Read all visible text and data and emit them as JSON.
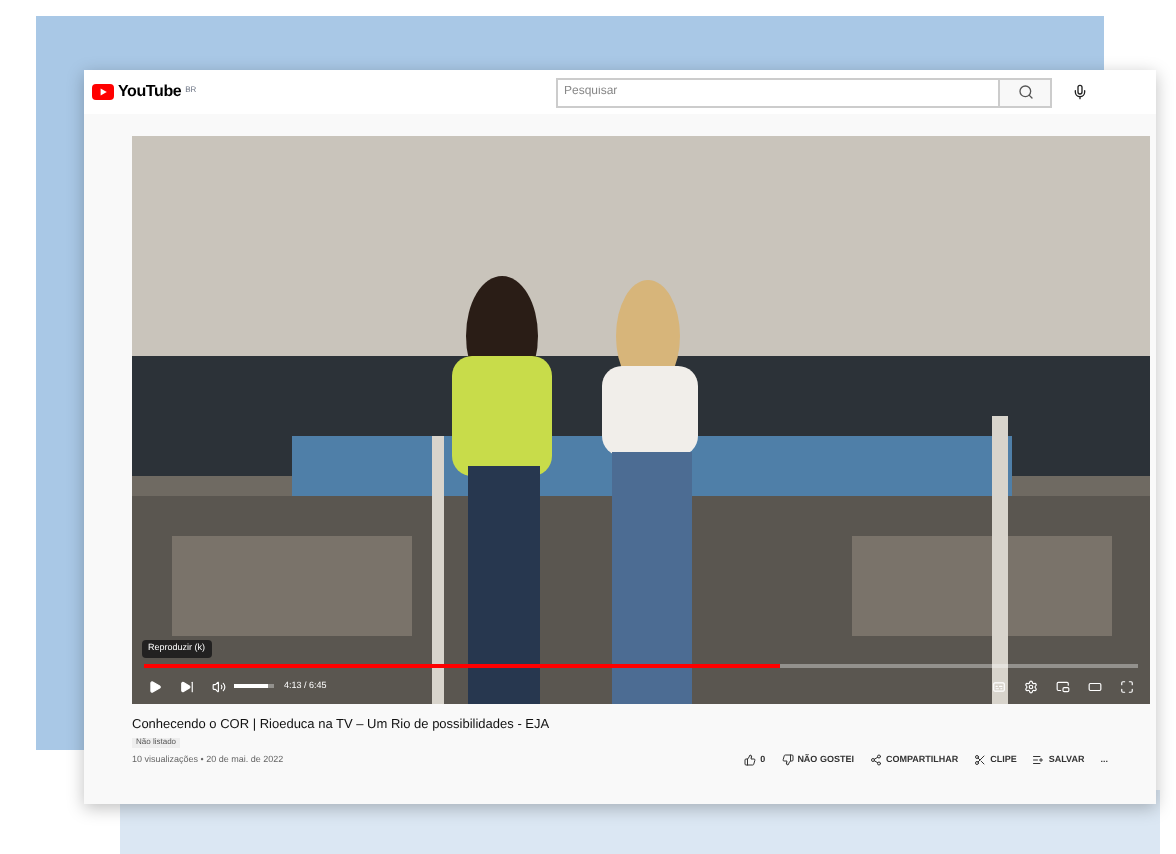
{
  "header": {
    "logo": "YouTube",
    "region": "BR",
    "search": {
      "placeholder": "Pesquisar"
    }
  },
  "player": {
    "tooltip": "Reproduzir (k)",
    "progress": {
      "level": 0.64
    },
    "volume": {
      "level": 0.85
    },
    "time": "4:13 / 6:45"
  },
  "video": {
    "title": "Conhecendo o COR | Rioeduca na TV – Um Rio de possibilidades - EJA",
    "badge": "Não listado",
    "meta": "10 visualizações • 20 de mai. de 2022"
  },
  "actions": [
    {
      "kind": "like",
      "label": "0"
    },
    {
      "kind": "dislike",
      "label": "NÃO GOSTEI"
    },
    {
      "kind": "share",
      "label": "COMPARTILHAR"
    },
    {
      "kind": "clip",
      "label": "CLIPE"
    },
    {
      "kind": "save",
      "label": "SALVAR"
    },
    {
      "kind": "more",
      "label": "..."
    }
  ]
}
